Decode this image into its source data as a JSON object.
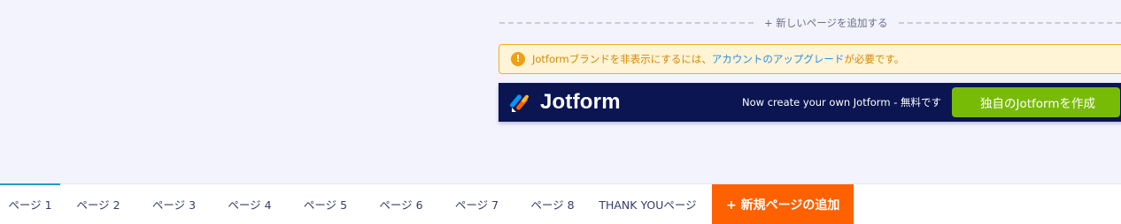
{
  "add_page_divider": {
    "label": "+ 新しいページを追加する"
  },
  "warning": {
    "text_before": "Jotformブランドを非表示にするには、",
    "link_text": "アカウントのアップグレード",
    "text_after": "が必要です。",
    "icon": "exclamation-icon",
    "accent_color": "#f2b01e"
  },
  "brand_bar": {
    "logo_text": "Jotform",
    "message": "Now create your own Jotform - 無料です",
    "cta_label": "独自のJotformを作成",
    "background": "#0a1551",
    "cta_color": "#78bb07"
  },
  "page_tabs": {
    "items": [
      {
        "label": "ページ 1",
        "active": true
      },
      {
        "label": "ページ 2"
      },
      {
        "label": "ページ 3"
      },
      {
        "label": "ページ 4"
      },
      {
        "label": "ページ 5"
      },
      {
        "label": "ページ 6"
      },
      {
        "label": "ページ 7"
      },
      {
        "label": "ページ 8"
      },
      {
        "label": "THANK YOUページ"
      }
    ],
    "add_label": "+ 新規ページの追加",
    "add_color": "#ff6100"
  }
}
